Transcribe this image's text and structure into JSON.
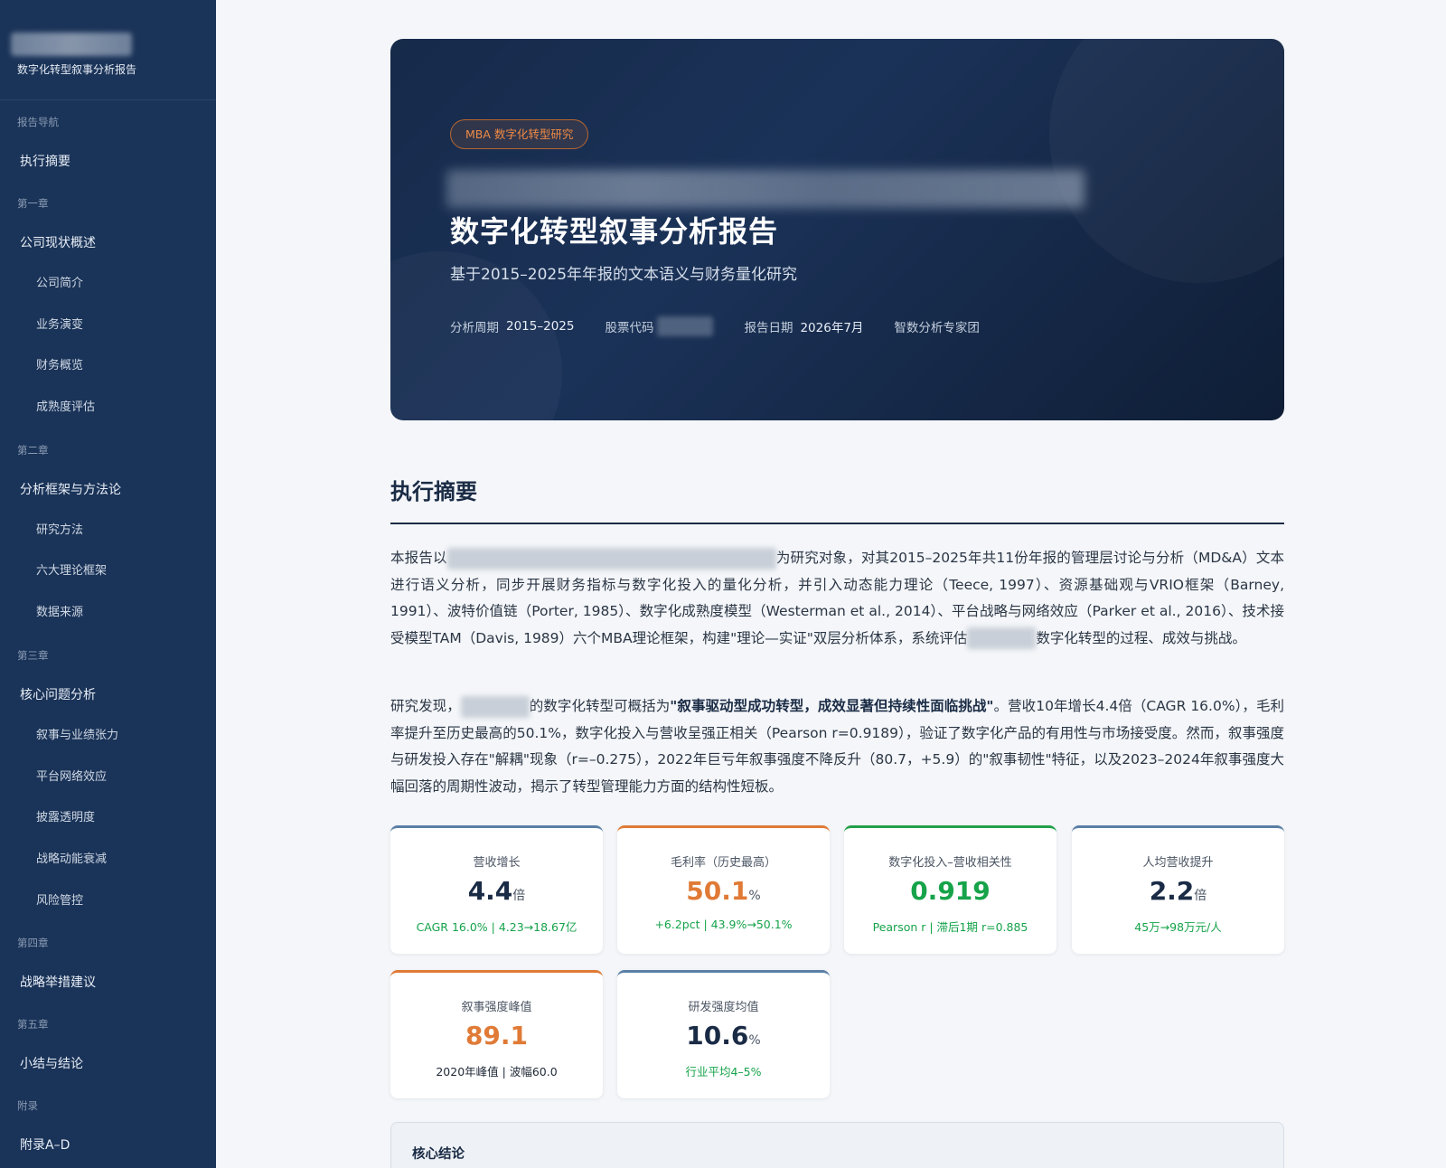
{
  "sidebar": {
    "subtitle": "数字化转型叙事分析报告",
    "groups": [
      {
        "title": "报告导航",
        "items": [
          {
            "label": "执行摘要",
            "sub": []
          }
        ]
      },
      {
        "title": "第一章",
        "items": [
          {
            "label": "公司现状概述",
            "sub": [
              "公司简介",
              "业务演变",
              "财务概览",
              "成熟度评估"
            ]
          }
        ]
      },
      {
        "title": "第二章",
        "items": [
          {
            "label": "分析框架与方法论",
            "sub": [
              "研究方法",
              "六大理论框架",
              "数据来源"
            ]
          }
        ]
      },
      {
        "title": "第三章",
        "items": [
          {
            "label": "核心问题分析",
            "sub": [
              "叙事与业绩张力",
              "平台网络效应",
              "披露透明度",
              "战略动能衰减",
              "风险管控"
            ]
          }
        ]
      },
      {
        "title": "第四章",
        "items": [
          {
            "label": "战略举措建议",
            "sub": []
          }
        ]
      },
      {
        "title": "第五章",
        "items": [
          {
            "label": "小结与结论",
            "sub": []
          }
        ]
      },
      {
        "title": "附录",
        "items": [
          {
            "label": "附录A–D",
            "sub": []
          }
        ]
      }
    ]
  },
  "hero": {
    "badge": "MBA 数字化转型研究",
    "title": "数字化转型叙事分析报告",
    "subtitle": "基于2015–2025年年报的文本语义与财务量化研究",
    "meta": {
      "period_label": "分析周期",
      "period_value": "2015–2025",
      "code_label": "股票代码",
      "date_label": "报告日期",
      "date_value": "2026年7月",
      "team": "智数分析专家团"
    }
  },
  "summary": {
    "title": "执行摘要",
    "p1_a": "本报告以",
    "p1_b": "为研究对象，对其2015–2025年共11份年报的管理层讨论与分析（MD&A）文本进行语义分析，同步开展财务指标与数字化投入的量化分析，并引入动态能力理论（Teece, 1997）、资源基础观与VRIO框架（Barney, 1991）、波特价值链（Porter, 1985）、数字化成熟度模型（Westerman et al., 2014）、平台战略与网络效应（Parker et al., 2016）、技术接受模型TAM（Davis, 1989）六个MBA理论框架，构建\"理论—实证\"双层分析体系，系统评估",
    "p1_c": "数字化转型的过程、成效与挑战。",
    "p2_a": "研究发现，",
    "p2_b": "的数字化转型可概括为",
    "p2_strong": "\"叙事驱动型成功转型，成效显著但持续性面临挑战\"",
    "p2_c": "。营收10年增长4.4倍（CAGR 16.0%），毛利率提升至历史最高的50.1%，数字化投入与营收呈强正相关（Pearson r=0.9189），验证了数字化产品的有用性与市场接受度。然而，叙事强度与研发投入存在\"解耦\"现象（r=–0.275），2022年巨亏年叙事强度不降反升（80.7，+5.9）的\"叙事韧性\"特征，以及2023–2024年叙事强度大幅回落的周期性波动，揭示了转型管理能力方面的结构性短板。"
  },
  "kpis": [
    {
      "label": "营收增长",
      "value": "4.4",
      "unit": "倍",
      "note": "CAGR 16.0% | 4.23→18.67亿"
    },
    {
      "label": "毛利率（历史最高）",
      "value": "50.1",
      "unit": "%",
      "note": "+6.2pct | 43.9%→50.1%"
    },
    {
      "label": "数字化投入–营收相关性",
      "value": "0.919",
      "unit": "",
      "note": "Pearson r | 滞后1期 r=0.885"
    },
    {
      "label": "人均营收提升",
      "value": "2.2",
      "unit": "倍",
      "note": "45万→98万元/人"
    },
    {
      "label": "叙事强度峰值",
      "value": "89.1",
      "unit": "",
      "note": "2020年峰值 | 波幅60.0"
    },
    {
      "label": "研发强度均值",
      "value": "10.6",
      "unit": "%",
      "note": "行业平均4–5%"
    }
  ],
  "conclusion": {
    "title": "核心结论"
  },
  "colors": {
    "sidebar_bg": "#1a3358",
    "accent_orange": "#e07a36",
    "accent_green": "#16a34a",
    "navy": "#1a2b45"
  }
}
